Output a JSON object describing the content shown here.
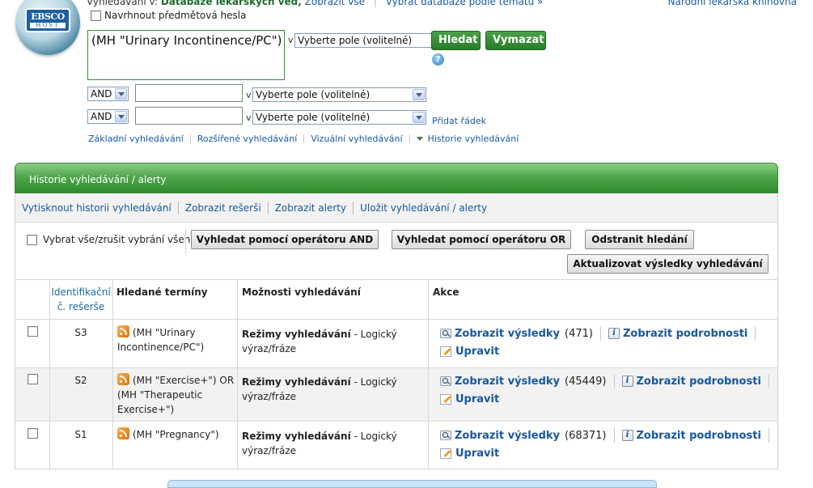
{
  "header": {
    "logo_text": "EBSCO",
    "logo_subtext": "HOST",
    "searching_prefix": "Vyhledávání v:",
    "database_name": "Databáze lékařských věd,",
    "show_all_link": "Zobrazit vše",
    "choose_db_link": "Vybrat databáze podle tématu »",
    "library_name": "Národní lékařská knihovna"
  },
  "search": {
    "suggest_label": "Navrhnout předmětová hesla",
    "query_value": "(MH \"Urinary Incontinence/PC\")",
    "in_label": "v",
    "field_select": "Vyberte pole (volitelné)",
    "search_button": "Hledat",
    "clear_button": "Vymazat",
    "help_icon": "?",
    "rows": [
      {
        "operator": "AND",
        "value": "",
        "in_label": "v",
        "field": "Vyberte pole (volitelné)"
      },
      {
        "operator": "AND",
        "value": "",
        "in_label": "v",
        "field": "Vyberte pole (volitelné)"
      }
    ],
    "add_row": "Přidat řádek",
    "modes": {
      "basic": "Základní vyhledávání",
      "advanced": "Rozšířené vyhledávání",
      "visual": "Vizuální vyhledávání",
      "history": "Historie vyhledávání"
    }
  },
  "history": {
    "title": "Historie vyhledávání / alerty",
    "actions": {
      "print": "Vytisknout historii vyhledávání",
      "show_research": "Zobrazit rešerši",
      "show_alerts": "Zobrazit alerty",
      "save": "Uložit vyhledávání / alerty"
    },
    "select_all": "Vybrat vše/zrušit vybrání všeho",
    "buttons": {
      "and": "Vyhledat pomocí operátoru AND",
      "or": "Vyhledat pomocí operátoru OR",
      "remove": "Odstranit hledání",
      "update": "Aktualizovat výsledky vyhledávání"
    },
    "columns": {
      "id_line1": "Identifikační",
      "id_line2": "č. rešerše",
      "terms": "Hledané termíny",
      "options": "Možnosti vyhledávání",
      "actions": "Akce"
    },
    "mode_label": "Režimy vyhledávání",
    "mode_value": "- Logický výraz/fráze",
    "show_results": "Zobrazit výsledky",
    "show_details": "Zobrazit podrobnosti",
    "edit": "Upravit",
    "rows": [
      {
        "id": "S3",
        "terms_line1": "(MH \"Urinary",
        "terms_line2": "Incontinence/PC\")",
        "terms_line3": "",
        "count": "(471)"
      },
      {
        "id": "S2",
        "terms_line1": "(MH \"Exercise+\") OR",
        "terms_line2": "(MH \"Therapeutic",
        "terms_line3": "Exercise+\")",
        "count": "(45449)"
      },
      {
        "id": "S1",
        "terms_line1": "(MH \"Pregnancy\")",
        "terms_line2": "",
        "terms_line3": "",
        "count": "(68371)"
      }
    ]
  }
}
